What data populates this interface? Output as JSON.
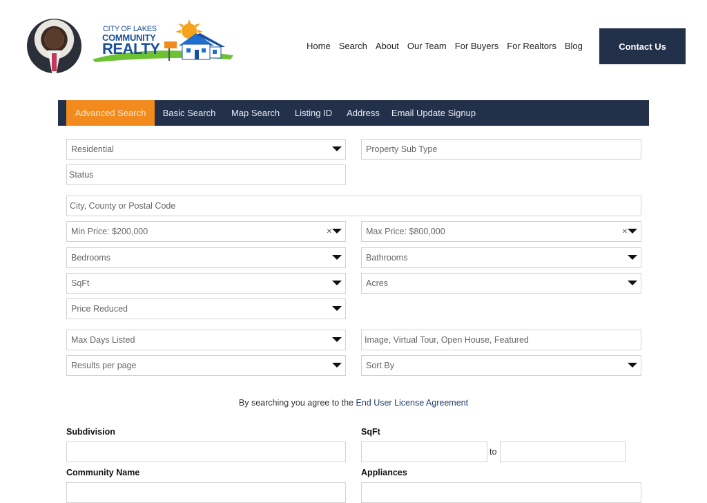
{
  "logo": {
    "line1": "CITY OF LAKES",
    "line2": "COMMUNITY",
    "line3": "REALTY"
  },
  "nav": [
    "Home",
    "Search",
    "About",
    "Our Team",
    "For Buyers",
    "For Realtors",
    "Blog"
  ],
  "contact_label": "Contact Us",
  "tabs": [
    "Advanced Search",
    "Basic Search",
    "Map Search",
    "Listing ID",
    "Address",
    "Email Update Signup"
  ],
  "form": {
    "property_type": "Residential",
    "property_sub_type": "Property Sub Type",
    "status": "Status",
    "location": "City, County or Postal Code",
    "min_price": "Min Price: $200,000",
    "max_price": "Max Price: $800,000",
    "bedrooms": "Bedrooms",
    "bathrooms": "Bathrooms",
    "sqft": "SqFt",
    "acres": "Acres",
    "price_reduced": "Price Reduced",
    "max_days_listed": "Max Days Listed",
    "features": "Image, Virtual Tour, Open House, Featured",
    "results_per_page": "Results per page",
    "sort_by": "Sort By"
  },
  "eula": {
    "prefix": "By searching you agree to the",
    "link": "End User License Agreement"
  },
  "extra": {
    "subdivision": "Subdivision",
    "sqft": "SqFt",
    "to": "to",
    "community_name": "Community Name",
    "appliances": "Appliances"
  },
  "colors": {
    "navy": "#23304a",
    "orange": "#f28a1e",
    "logo_blue": "#1b4f9c"
  }
}
